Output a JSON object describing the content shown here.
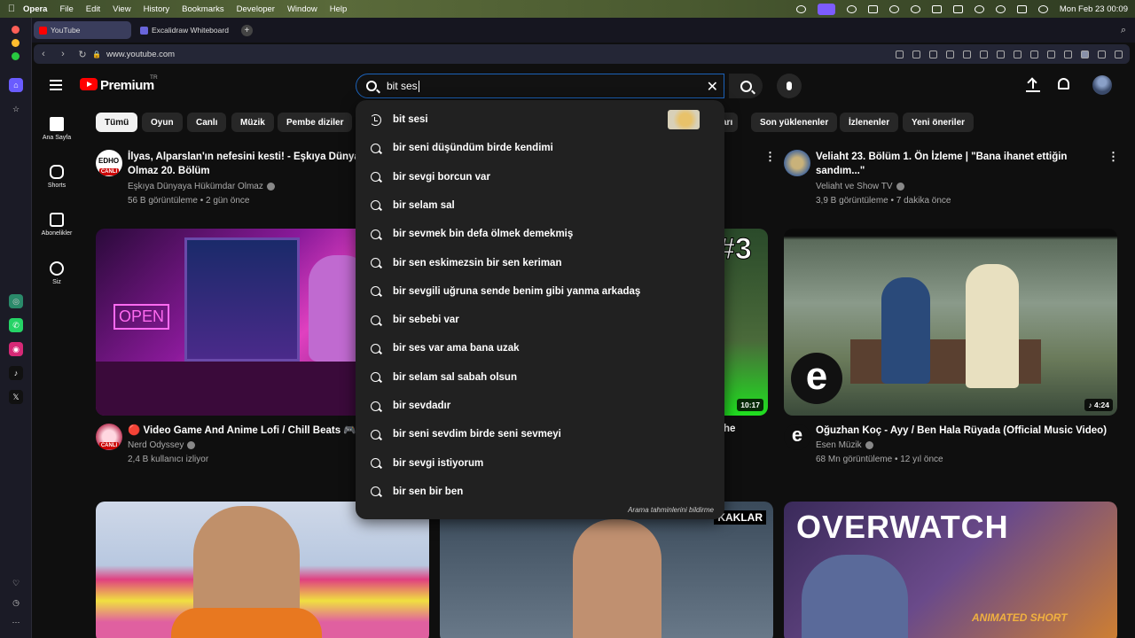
{
  "macbar": {
    "app": "Opera",
    "menus": [
      "File",
      "Edit",
      "View",
      "History",
      "Bookmarks",
      "Developer",
      "Window",
      "Help"
    ],
    "clock": "Mon Feb 23  00:09"
  },
  "tabs": [
    {
      "label": "YouTube",
      "active": true,
      "favicon_color": "#ff0000"
    },
    {
      "label": "Excalidraw Whiteboard",
      "active": false,
      "favicon_color": "#6965db"
    }
  ],
  "address": {
    "url": "www.youtube.com"
  },
  "yt": {
    "brand": "Premium",
    "region": "TR"
  },
  "search": {
    "value": "bit ses",
    "report_link": "Arama tahminlerini bildirme",
    "suggestions": [
      {
        "text": "bit sesi",
        "history": true
      },
      {
        "text": "bir seni düşündüm birde kendimi"
      },
      {
        "text": "bir sevgi borcun var"
      },
      {
        "text": "bir selam sal"
      },
      {
        "text": "bir sevmek bin defa ölmek demekmiş"
      },
      {
        "text": "bir sen eskimezsin bir sen keriman"
      },
      {
        "text": "bir sevgili uğruna sende benim gibi yanma arkadaş"
      },
      {
        "text": "bir sebebi var"
      },
      {
        "text": "bir ses var ama bana uzak"
      },
      {
        "text": "bir selam sal sabah olsun"
      },
      {
        "text": "bir sevdadır"
      },
      {
        "text": "bir seni sevdim birde seni sevmeyi"
      },
      {
        "text": "bir sevgi istiyorum"
      },
      {
        "text": "bir sen bir ben"
      }
    ]
  },
  "leftnav": [
    "Ana Sayfa",
    "Shorts",
    "Abonelikler",
    "Siz"
  ],
  "chips": [
    "Tümü",
    "Oyun",
    "Canlı",
    "Müzik",
    "Pembe diziler",
    "arı",
    "Son yüklenenler",
    "İzlenenler",
    "Yeni öneriler"
  ],
  "videos": [
    {
      "title": "İlyas, Alparslan'ın nefesini kesti! - Eşkıya Dünyaya",
      "title2": "Olmaz 20. Bölüm",
      "channel": "Eşkıya Dünyaya Hükümdar Olmaz",
      "meta": "56 B görüntüleme • 2 gün önce",
      "badge": "CANLI",
      "logo": "EDHO"
    },
    {
      "title": "Veliaht 23. Bölüm 1. Ön İzleme | \"Bana ihanet ettiğin",
      "title2": "sandım...\"",
      "channel": "Veliaht ve Show TV",
      "meta": "3,9 B görüntüleme • 7 dakika önce"
    },
    {
      "title": "🔴 Video Game And Anime Lofi / Chill Beats 🎮 2",
      "channel": "Nerd Odyssey",
      "meta": "2,4 B kullanıcı izliyor",
      "badge": "CANLI",
      "neon": "OPEN"
    },
    {
      "title": "he",
      "duration": "10:17",
      "overlay": "#3"
    },
    {
      "title": "Oğuzhan Koç - Ayy / Ben Hala Rüyada  (Official Music Video)",
      "channel": "Esen Müzik",
      "meta": "68 Mn görüntüleme • 12 yıl önce",
      "duration": "♪ 4:24",
      "logo": "e"
    },
    {
      "overlay": "KAKLAR"
    },
    {
      "overlay": "OVERWATCH",
      "sub": "ANIMATED SHORT"
    }
  ]
}
